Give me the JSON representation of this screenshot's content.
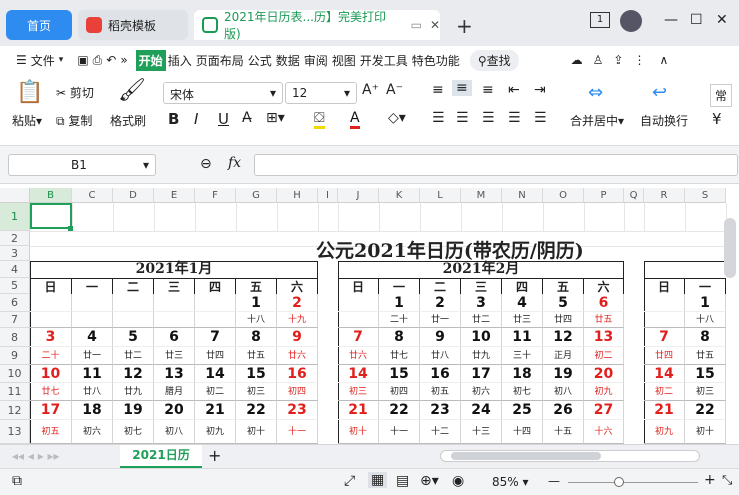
{
  "tabs": {
    "home": "首页",
    "template": "稻壳模板",
    "doc": "2021年日历表...历】完美打印版)",
    "new": "+",
    "badge": "1"
  },
  "menu": {
    "file": "文件",
    "items": [
      "开始",
      "插入",
      "页面布局",
      "公式",
      "数据",
      "审阅",
      "视图",
      "开发工具",
      "特色功能"
    ],
    "search": "查找",
    "more": "»"
  },
  "ribbon": {
    "paste": "粘贴",
    "cut": "剪切",
    "copy": "复制",
    "format_painter": "格式刷",
    "font": "宋体",
    "size": "12",
    "merge": "合并居中",
    "wrap": "自动换行",
    "style_cut": "常"
  },
  "formula": {
    "namebox": "B1",
    "fx": "fx"
  },
  "cols": [
    "B",
    "C",
    "D",
    "E",
    "F",
    "G",
    "H",
    "I",
    "J",
    "K",
    "L",
    "M",
    "N",
    "O",
    "P",
    "Q",
    "R",
    "S"
  ],
  "rows": [
    "1",
    "2",
    "3",
    "4",
    "5",
    "6",
    "7",
    "8",
    "9",
    "10",
    "11",
    "12",
    "13"
  ],
  "title": "公元2021年日历(带农历/阴历)",
  "weekdays": [
    "日",
    "一",
    "二",
    "三",
    "四",
    "五",
    "六"
  ],
  "jan": {
    "title": "2021年1月",
    "r6": [
      "",
      "",
      "",
      "",
      "",
      "1",
      "2"
    ],
    "r7": [
      "",
      "",
      "",
      "",
      "",
      "十八",
      "十九"
    ],
    "r8": [
      "3",
      "4",
      "5",
      "6",
      "7",
      "8",
      "9"
    ],
    "r9": [
      "二十",
      "廿一",
      "廿二",
      "廿三",
      "廿四",
      "廿五",
      "廿六"
    ],
    "r10": [
      "10",
      "11",
      "12",
      "13",
      "14",
      "15",
      "16"
    ],
    "r11": [
      "廿七",
      "廿八",
      "廿九",
      "腊月",
      "初二",
      "初三",
      "初四"
    ],
    "r12": [
      "17",
      "18",
      "19",
      "20",
      "21",
      "22",
      "23"
    ],
    "r13": [
      "初五",
      "初六",
      "初七",
      "初八",
      "初九",
      "初十",
      "十一"
    ]
  },
  "feb": {
    "title": "2021年2月",
    "r6": [
      "",
      "1",
      "2",
      "3",
      "4",
      "5",
      "6"
    ],
    "r7": [
      "",
      "二十",
      "廿一",
      "廿二",
      "廿三",
      "廿四",
      "廿五"
    ],
    "r8": [
      "7",
      "8",
      "9",
      "10",
      "11",
      "12",
      "13"
    ],
    "r9": [
      "廿六",
      "廿七",
      "廿八",
      "廿九",
      "三十",
      "正月",
      "初二"
    ],
    "r10": [
      "14",
      "15",
      "16",
      "17",
      "18",
      "19",
      "20"
    ],
    "r11": [
      "初三",
      "初四",
      "初五",
      "初六",
      "初七",
      "初八",
      "初九"
    ],
    "r12": [
      "21",
      "22",
      "23",
      "24",
      "25",
      "26",
      "27"
    ],
    "r13": [
      "初十",
      "十一",
      "十二",
      "十三",
      "十四",
      "十五",
      "十六"
    ]
  },
  "mar": {
    "r6": [
      "",
      "1"
    ],
    "r7": [
      "",
      "十八"
    ],
    "r8": [
      "7",
      "8"
    ],
    "r9": [
      "廿四",
      "廿五"
    ],
    "r10": [
      "14",
      "15"
    ],
    "r11": [
      "初二",
      "初三"
    ],
    "r12": [
      "21",
      "22"
    ],
    "r13": [
      "初九",
      "初十"
    ]
  },
  "sheet": {
    "name": "2021日历",
    "add": "+"
  },
  "status": {
    "zoom": "85%",
    "zoom_minus": "—",
    "zoom_plus": "+"
  }
}
